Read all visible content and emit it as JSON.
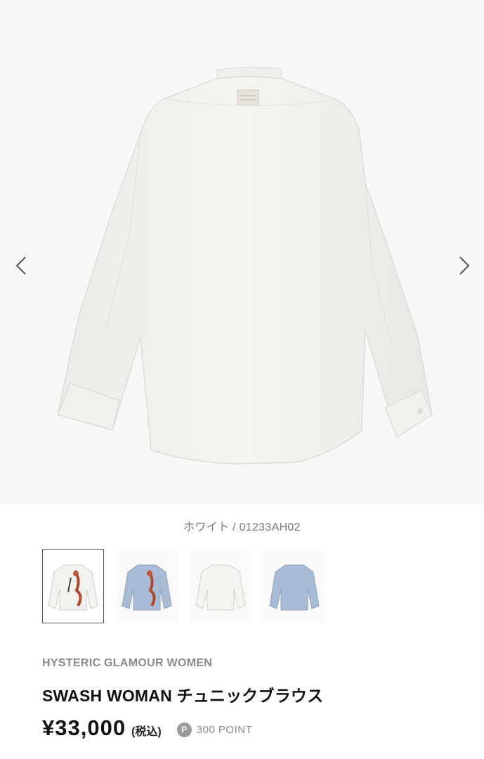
{
  "gallery": {
    "prev_icon": "chevron-left-icon",
    "next_icon": "chevron-right-icon",
    "main_image": "white-shirt-back-view"
  },
  "variant_caption": "ホワイト / 01233AH02",
  "thumbnails": [
    {
      "name": "white-shirt-print",
      "selected": true
    },
    {
      "name": "blue-shirt-print",
      "selected": false
    },
    {
      "name": "white-shirt-back",
      "selected": false
    },
    {
      "name": "blue-shirt-back",
      "selected": false
    }
  ],
  "product": {
    "brand": "HYSTERIC GLAMOUR WOMEN",
    "name": "SWASH WOMAN チュニックブラウス",
    "price": "¥33,000",
    "tax_label": "(税込)",
    "points_badge": "P",
    "points_text": "300 POINT"
  },
  "colors": {
    "background": "#ffffff",
    "image_bg": "#f7f7f7",
    "shirt_white": "#f2f2ee",
    "shirt_blue": "#a9bcd6",
    "muted_text": "#8a8a8a"
  }
}
